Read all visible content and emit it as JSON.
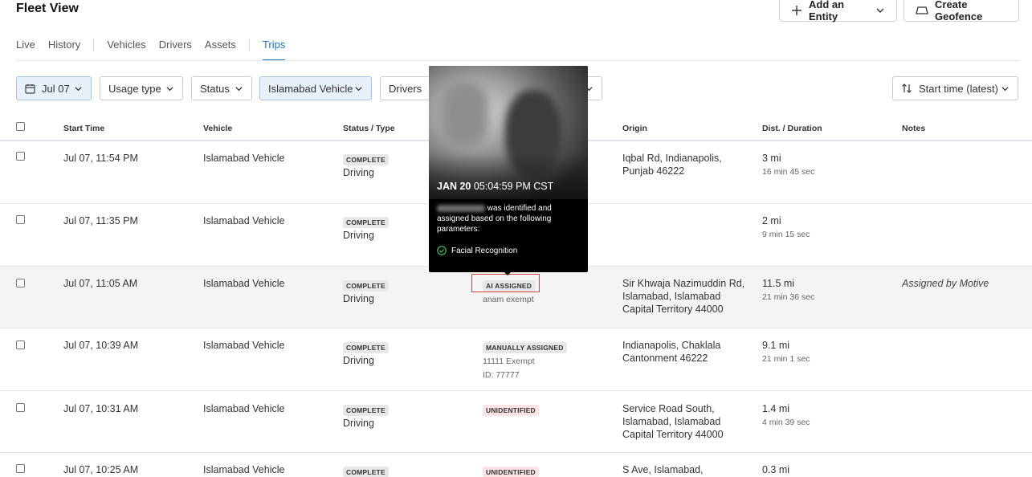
{
  "page": {
    "title": "Fleet View"
  },
  "header_actions": {
    "add_entity": "Add an Entity",
    "create_geofence": "Create Geofence"
  },
  "tabs": [
    "Live",
    "History",
    "Vehicles",
    "Drivers",
    "Assets",
    "Trips"
  ],
  "active_tab": "Trips",
  "filters": {
    "date": "Jul 07",
    "usage_type": "Usage type",
    "status": "Status",
    "vehicle": "Islamabad Vehicle",
    "drivers": "Drivers",
    "sort": "Start time (latest)"
  },
  "columns": {
    "start_time": "Start Time",
    "vehicle": "Vehicle",
    "status_type": "Status / Type",
    "origin": "Origin",
    "dist_duration": "Dist. / Duration",
    "notes": "Notes"
  },
  "rows": [
    {
      "start": "Jul 07, 11:54 PM",
      "vehicle": "Islamabad Vehicle",
      "status": "COMPLETE",
      "type": "Driving",
      "driver_badge": "",
      "driver_name": "",
      "driver_id": "",
      "origin": "Iqbal Rd, Indianapolis, Punjab 46222",
      "dist": "3 mi",
      "duration": "16 min 45 sec",
      "notes": ""
    },
    {
      "start": "Jul 07, 11:35 PM",
      "vehicle": "Islamabad Vehicle",
      "status": "COMPLETE",
      "type": "Driving",
      "driver_badge": "",
      "driver_name": "",
      "driver_id": "",
      "origin": "",
      "dist": "2 mi",
      "duration": "9 min 15 sec",
      "notes": ""
    },
    {
      "start": "Jul 07, 11:05 AM",
      "vehicle": "Islamabad Vehicle",
      "status": "COMPLETE",
      "type": "Driving",
      "driver_badge": "AI ASSIGNED",
      "driver_name": "anam exempt",
      "driver_id": "",
      "origin": "Sir Khwaja Nazimuddin Rd, Islamabad, Islamabad Capital Territory 44000",
      "dist": "11.5 mi",
      "duration": "21 min 36 sec",
      "notes": "Assigned by Motive"
    },
    {
      "start": "Jul 07, 10:39 AM",
      "vehicle": "Islamabad Vehicle",
      "status": "COMPLETE",
      "type": "Driving",
      "driver_badge": "MANUALLY ASSIGNED",
      "driver_name": "11111 Exempt",
      "driver_id": "ID: 77777",
      "origin": "Indianapolis, Chaklala Cantonment 46222",
      "dist": "9.1 mi",
      "duration": "21 min 1 sec",
      "notes": ""
    },
    {
      "start": "Jul 07, 10:31 AM",
      "vehicle": "Islamabad Vehicle",
      "status": "COMPLETE",
      "type": "Driving",
      "driver_badge": "UNIDENTIFIED",
      "driver_name": "",
      "driver_id": "",
      "origin": "Service Road South, Islamabad, Islamabad Capital Territory 44000",
      "dist": "1.4 mi",
      "duration": "4 min 39 sec",
      "notes": ""
    },
    {
      "start": "Jul 07, 10:25 AM",
      "vehicle": "Islamabad Vehicle",
      "status": "COMPLETE",
      "type": "",
      "driver_badge": "UNIDENTIFIED",
      "driver_name": "",
      "driver_id": "",
      "origin": "S Ave, Islamabad,",
      "dist": "0.3 mi",
      "duration": "",
      "notes": ""
    }
  ],
  "tooltip": {
    "date": "JAN 20",
    "time": "05:04:59 PM CST",
    "message": "was identified and assigned based on the following parameters:",
    "parameter": "Facial Recognition"
  }
}
